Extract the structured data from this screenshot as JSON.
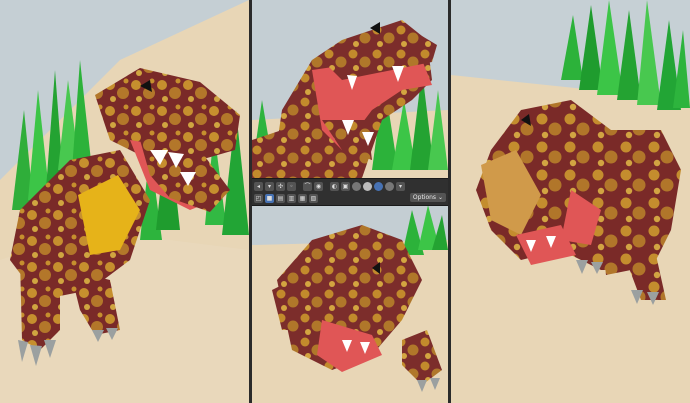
{
  "toolbar": {
    "options_label": "Options ⌄",
    "row1_icons": [
      "view-icon",
      "select-mode-icon",
      "transform-icon",
      "pivot-icon",
      "snap-icon",
      "proportional-icon",
      "overlay-icon",
      "xray-icon",
      "wireframe-shading-icon",
      "solid-shading-icon",
      "material-shading-icon",
      "rendered-shading-icon",
      "shading-options-icon"
    ],
    "row2_icons": [
      "select-box-icon",
      "mode-new-icon",
      "mode-extend-icon",
      "mode-subtract-icon",
      "mode-invert-icon",
      "mode-intersect-icon"
    ]
  },
  "colors": {
    "sky": "#c3cdd2",
    "ground": "#e9d6b8",
    "tree_green": "#28b838",
    "dino_red": "#7a2a28",
    "dino_spot": "#c8932c",
    "mouth": "#e05656",
    "belly": "#e6b319"
  }
}
